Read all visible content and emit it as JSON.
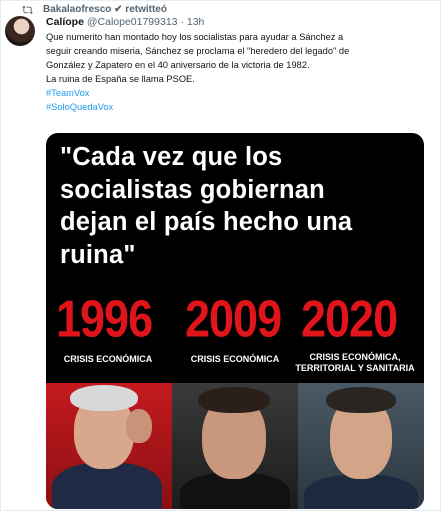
{
  "retweet": {
    "text": "Bakalaofresco ✔ retwitteó"
  },
  "tweet": {
    "name": "Calíope",
    "handle": "@Calope01799313",
    "separator": "·",
    "time": "13h",
    "text_lines": [
      "Que numerito han montado hoy los socialistas para ayudar a Sánchez a",
      "seguir creando miseria, Sánchez se proclama el \"heredero del legado\" de",
      "González y Zapatero en el 40 aniversario de la victoria de 1982.",
      "La ruina de España se llama PSOE."
    ],
    "hashtags": [
      "#TeamVox",
      "#SoloQuedaVox"
    ]
  },
  "image": {
    "quote_lines": [
      "\"Cada vez que los",
      "socialistas gobiernan",
      "dejan el país hecho una",
      "ruina\""
    ],
    "years": [
      "1996",
      "2009",
      "2020"
    ],
    "crisis": [
      [
        "CRISIS ECONÓMICA"
      ],
      [
        "CRISIS ECONÓMICA"
      ],
      [
        "CRISIS ECONÓMICA,",
        "TERRITORIAL Y SANITARIA"
      ]
    ],
    "colors": {
      "year": "#e0141b",
      "background": "#000000",
      "text": "#ffffff",
      "hashtag": "#1d9bf0"
    }
  }
}
